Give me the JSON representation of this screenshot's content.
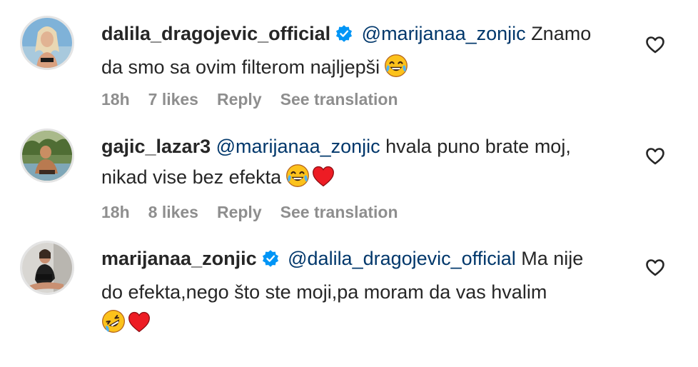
{
  "comments": [
    {
      "username": "dalila_dragojevic_official",
      "verified": true,
      "mention": "@marijanaa_zonjic",
      "text_line1": "Znamo",
      "text_line2": "da smo sa ovim filterom najljepši",
      "emojis": [
        "face-with-tears-of-joy"
      ],
      "time": "18h",
      "likes": "7 likes",
      "reply": "Reply",
      "translate": "See translation"
    },
    {
      "username": "gajic_lazar3",
      "verified": false,
      "mention": "@marijanaa_zonjic",
      "text_line1": "hvala puno brate moj,",
      "text_line2": "nikad vise bez efekta",
      "emojis": [
        "face-with-tears-of-joy",
        "red-heart"
      ],
      "time": "18h",
      "likes": "8 likes",
      "reply": "Reply",
      "translate": "See translation"
    },
    {
      "username": "marijanaa_zonjic",
      "verified": true,
      "mention": "@dalila_dragojevic_official",
      "text_line1": "Ma nije",
      "text_line2": "do efekta,nego što ste moji,pa moram da vas hvalim",
      "emojis": [
        "rolling-on-floor-laughing",
        "red-heart"
      ]
    }
  ],
  "colors": {
    "text": "#262626",
    "mention": "#00376b",
    "meta": "#8e8e8e",
    "verified": "#0095f6",
    "heart": "#ed1c24"
  }
}
